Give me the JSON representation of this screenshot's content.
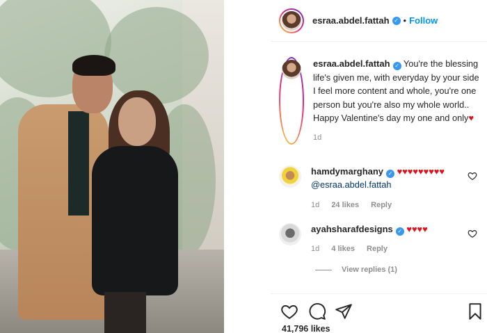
{
  "post": {
    "author": "esraa.abdel.fattah",
    "follow_label": "Follow",
    "separator": "•",
    "caption": {
      "author": "esraa.abdel.fattah",
      "text": "You're the blessing life's given me, with everyday by your side I feel more content and whole, you're one person but you're also my whole world.. Happy Valentine's day my one and only",
      "heart": "♥",
      "time": "1d"
    },
    "comments": [
      {
        "user": "hamdymarghany",
        "hearts": "♥♥♥♥♥♥♥♥♥",
        "mention": "@esraa.abdel.fattah",
        "time": "1d",
        "likes": "24 likes",
        "reply_label": "Reply"
      },
      {
        "user": "ayahsharafdesigns",
        "hearts": "♥♥♥♥",
        "time": "1d",
        "likes": "4 likes",
        "reply_label": "Reply"
      }
    ],
    "view_replies": "View replies (1)",
    "likes_count": "41,796 likes"
  },
  "icons": {
    "verified": "verified-badge-icon",
    "like": "heart-outline-icon",
    "comment": "comment-bubble-icon",
    "share": "paper-plane-icon",
    "save": "bookmark-icon"
  },
  "colors": {
    "accent": "#0095f6",
    "heart": "#e0111f",
    "muted": "#8e8e8e"
  }
}
